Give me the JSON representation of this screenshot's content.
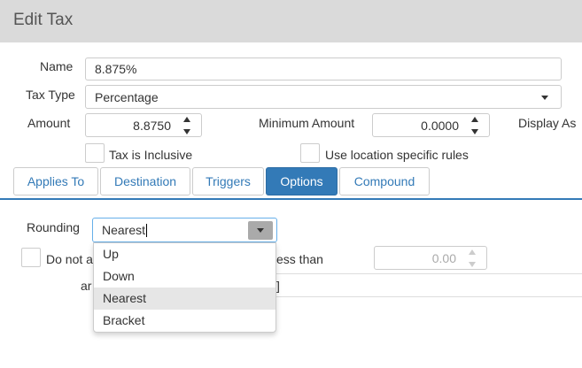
{
  "dialog": {
    "title": "Edit Tax"
  },
  "form": {
    "name_label": "Name",
    "name_value": "8.875%",
    "tax_type_label": "Tax Type",
    "tax_type_value": "Percentage",
    "amount_label": "Amount",
    "amount_value": "8.8750",
    "min_amount_label": "Minimum Amount",
    "min_amount_value": "0.0000",
    "display_as_label": "Display As",
    "tax_inclusive_label": "Tax is Inclusive",
    "location_rules_label": "Use location specific rules"
  },
  "tabs": [
    {
      "label": "Applies To",
      "active": false
    },
    {
      "label": "Destination",
      "active": false
    },
    {
      "label": "Triggers",
      "active": false
    },
    {
      "label": "Options",
      "active": true
    },
    {
      "label": "Compound",
      "active": false
    }
  ],
  "options": {
    "rounding_label": "Rounding",
    "rounding_value": "Nearest",
    "dropdown_options": [
      "Up",
      "Down",
      "Nearest",
      "Bracket"
    ],
    "highlighted_option": "Nearest",
    "do_not_label_partial": "Do not a",
    "less_than_partial": "ess than",
    "threshold_value": "0.00",
    "and_partial": "ar",
    "bracket_partial": "]"
  },
  "colors": {
    "accent": "#337ab7",
    "header_bg": "#dadada",
    "highlight": "#e6e6e6"
  }
}
